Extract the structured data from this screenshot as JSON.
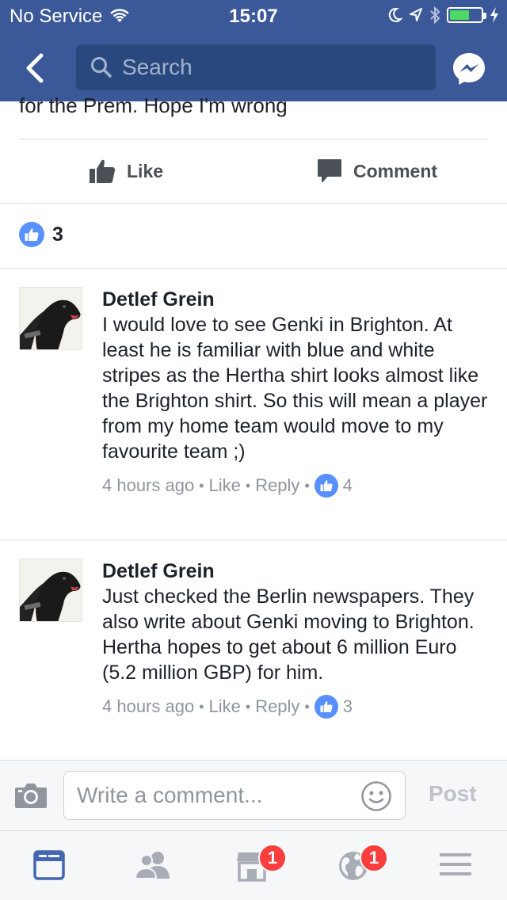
{
  "status_bar": {
    "carrier": "No Service",
    "time": "15:07"
  },
  "nav": {
    "search_placeholder": "Search"
  },
  "post": {
    "text_tail": "for the Prem. Hope I'm wrong",
    "like_label": "Like",
    "comment_label": "Comment",
    "like_count": "3"
  },
  "comments": [
    {
      "author": "Detlef Grein",
      "text": "I would love to see Genki in Brighton. At least he is familiar with blue and white stripes as the Hertha shirt looks almost like the Brighton shirt. So this will mean a player from my home team would move to my favourite team ;)",
      "time": "4 hours ago",
      "like_label": "Like",
      "reply_label": "Reply",
      "likes": "4"
    },
    {
      "author": "Detlef Grein",
      "text": "Just checked the Berlin newspapers. They also write about Genki moving to Brighton. Hertha hopes to get about 6 million Euro (5.2 million GBP) for him.",
      "time": "4 hours ago",
      "like_label": "Like",
      "reply_label": "Reply",
      "likes": "3"
    }
  ],
  "composer": {
    "placeholder": "Write a comment...",
    "post_label": "Post"
  },
  "tabbar": {
    "marketplace_badge": "1",
    "notifications_badge": "1"
  },
  "colors": {
    "brand": "#3b5998",
    "search_bg": "#29487d",
    "like_blue": "#5890ff",
    "badge_red": "#fa3e3e",
    "battery_green": "#4cd964"
  }
}
